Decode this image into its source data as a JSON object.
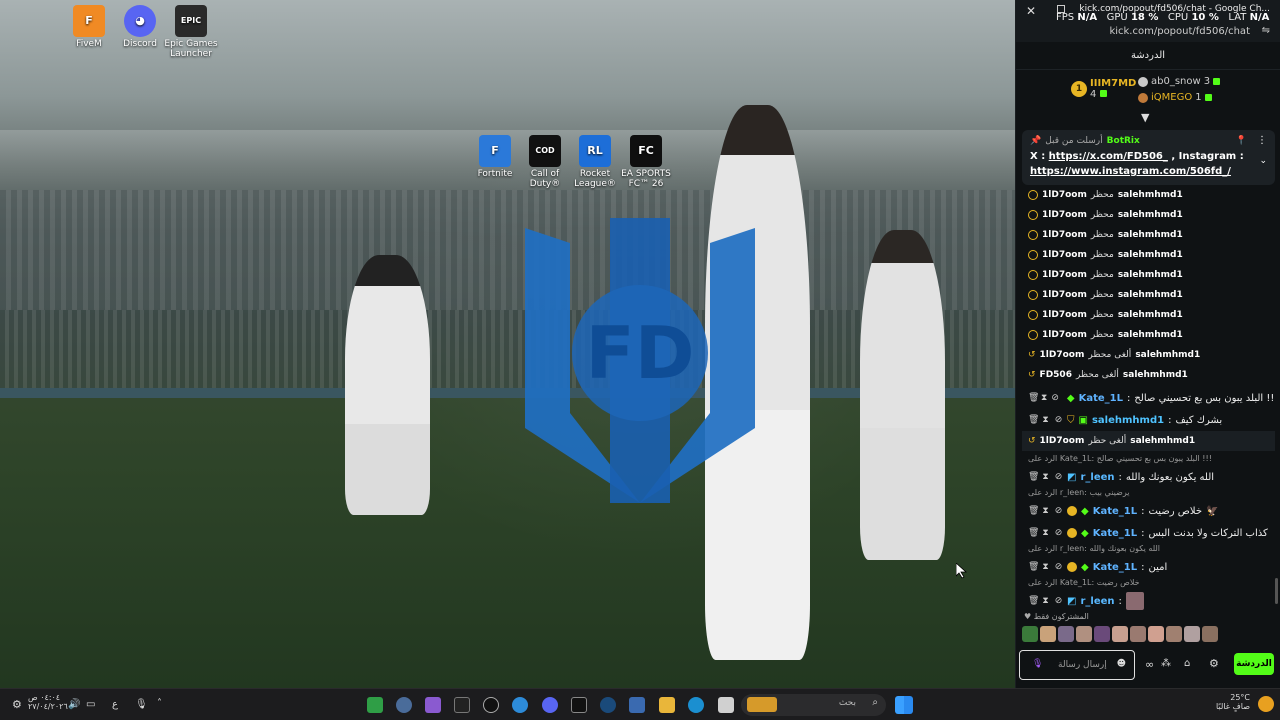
{
  "desktop": {
    "icons": [
      {
        "label": "FiveM",
        "glyph": "F",
        "color": "#f08a24"
      },
      {
        "label": "Discord",
        "glyph": "◕",
        "color": "#5865f2"
      },
      {
        "label": "Epic Games Launcher",
        "glyph": "EPIC",
        "color": "#2a2a2a"
      },
      {
        "label": "Fortnite",
        "glyph": "F",
        "color": "#2b79d9"
      },
      {
        "label": "Call of Duty®",
        "glyph": "COD",
        "color": "#111111"
      },
      {
        "label": "Rocket League®",
        "glyph": "RL",
        "color": "#1d6ed8"
      },
      {
        "label": "EA SPORTS FC™ 26",
        "glyph": "FC",
        "color": "#0f0f0f"
      }
    ],
    "logo_text": "FD"
  },
  "browser": {
    "title": "kick.com/popout/fd506/chat - Google Ch...",
    "url": "kick.com/popout/fd506/chat"
  },
  "overlay": {
    "fps_label": "FPS",
    "fps_value": "N/A",
    "gpu_label": "GPU",
    "gpu_value": "18 %",
    "cpu_label": "CPU",
    "cpu_value": "10 %",
    "lat_label": "LAT",
    "lat_value": "N/A"
  },
  "chat": {
    "header": "الدردشة",
    "leaderboard": {
      "top": {
        "name": "IIIM7MD",
        "rank": "1",
        "count": "4"
      },
      "second": {
        "name": "ab0_snow",
        "count": "3"
      },
      "third": {
        "name": "iQMEGO",
        "count": "1"
      }
    },
    "pinned": {
      "sender": "BotRix",
      "note": "أرسلت من قبل",
      "line1_prefix": "X : ",
      "line1_link": "https://x.com/FD506_",
      "line1_mid": " , Instagram :",
      "line2_link": "https://www.instagram.com/506fd_/"
    },
    "events": [
      {
        "a": "1lD7oom",
        "action": "محظر",
        "b": "salehmhmd1"
      },
      {
        "a": "1lD7oom",
        "action": "محظر",
        "b": "salehmhmd1"
      },
      {
        "a": "1lD7oom",
        "action": "محظر",
        "b": "salehmhmd1"
      },
      {
        "a": "1lD7oom",
        "action": "محظر",
        "b": "salehmhmd1"
      },
      {
        "a": "1lD7oom",
        "action": "محظر",
        "b": "salehmhmd1"
      },
      {
        "a": "1lD7oom",
        "action": "محظر",
        "b": "salehmhmd1"
      },
      {
        "a": "1lD7oom",
        "action": "محظر",
        "b": "salehmhmd1"
      },
      {
        "a": "1lD7oom",
        "action": "محظر",
        "b": "salehmhmd1"
      },
      {
        "a": "1lD7oom",
        "action": "ألغى محظر",
        "b": "salehmhmd1"
      },
      {
        "a": "FD506",
        "action": "ألغى محظر",
        "b": "salehmhmd1"
      }
    ],
    "messages": [
      {
        "user": "Kate_1L",
        "color": "#5fb3ff",
        "text": "البلد يبون بس بع تحسيني صالح !!!",
        "reply": ""
      },
      {
        "user": "salehmhmd1",
        "color": "#4fc3ff",
        "text": "بشرك كيف",
        "reply": ""
      },
      {
        "user": "",
        "color": "",
        "text": "",
        "reply": "",
        "event": {
          "a": "1lD7oom",
          "action": "ألغى حظر",
          "b": "salehmhmd1"
        }
      },
      {
        "user": "r_leen",
        "color": "#59b8ff",
        "text": "الله يكون بعونك والله",
        "reply": "الرد على Kate_1L: البلد يبون بس بع تحسيني صالح !!!"
      },
      {
        "user": "Kate_1L",
        "color": "#5fb3ff",
        "text": "خلاص رضيت",
        "reply": "الرد على r_leen: يرضيني بيب"
      },
      {
        "user": "Kate_1L",
        "color": "#5fb3ff",
        "text": "كذاب التركات ولا بدنت البس",
        "reply": ""
      },
      {
        "user": "Kate_1L",
        "color": "#5fb3ff",
        "text": "امين",
        "reply": "الرد على r_leen: الله يكون بعونك والله"
      },
      {
        "user": "r_leen",
        "color": "#59b8ff",
        "text": "",
        "reply": "الرد على Kate_1L: خلاص رضيت"
      }
    ],
    "subs_label": "المشتركون فقط",
    "input_placeholder": "إرسال رسالة",
    "send_label": "الدردشة"
  },
  "taskbar": {
    "time": "٠٤:٠٤ ص",
    "date": "٢٧/٠٤/٢٠٢٦",
    "lang": "ع",
    "search_placeholder": "بحث",
    "weather_temp": "25°C",
    "weather_desc": "صافٍ غالبًا"
  }
}
